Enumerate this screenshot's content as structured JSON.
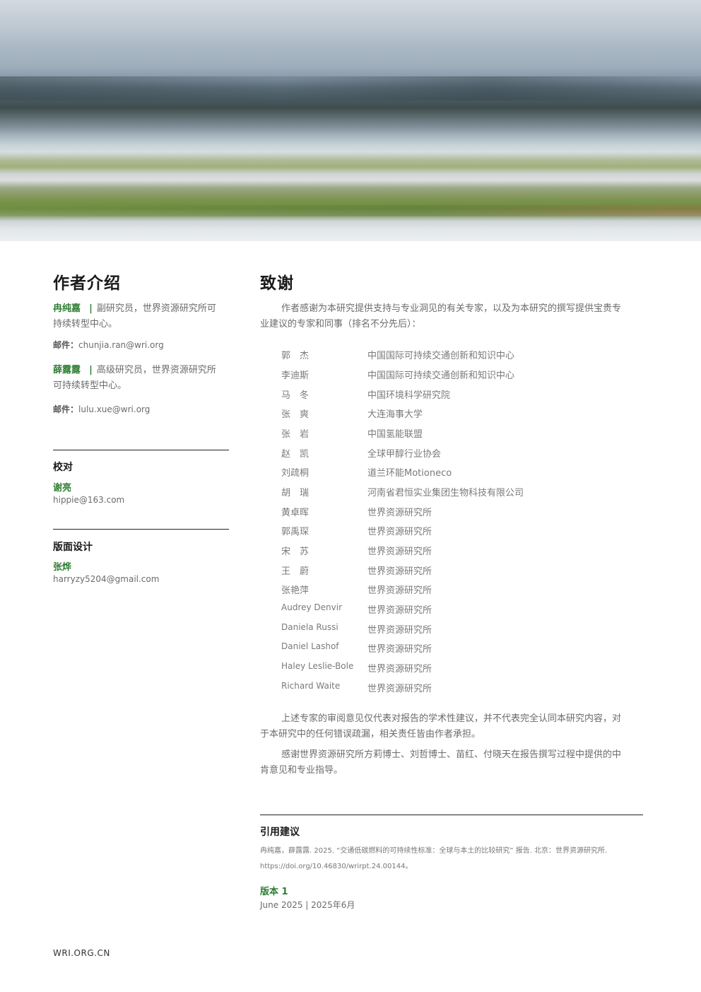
{
  "authors": {
    "heading": "作者介绍",
    "people": [
      {
        "name": "冉纯嘉",
        "sep": "|",
        "role_line1": "副研究员，世界资源研究所可",
        "role_line2": "持续转型中心。",
        "email_label": "邮件：",
        "email": "chunjia.ran@wri.org"
      },
      {
        "name": "薛露露",
        "sep": "|",
        "role_line1": "高级研究员，世界资源研究所",
        "role_line2": "可持续转型中心。",
        "email_label": "邮件：",
        "email": "lulu.xue@wri.org"
      }
    ],
    "proofread": {
      "title": "校对",
      "name": "谢亮",
      "email": "hippie@163.com"
    },
    "design": {
      "title": "版面设计",
      "name": "张烨",
      "email": "harryzy5204@gmail.com"
    }
  },
  "ack": {
    "heading": "致谢",
    "intro_line1": "作者感谢为本研究提供支持与专业洞见的有关专家，以及为本研究的撰写提供宝贵专",
    "intro_line2": "业建议的专家和同事（排名不分先后）：",
    "experts": [
      {
        "name": "郭　杰",
        "org": "中国国际可持续交通创新和知识中心"
      },
      {
        "name": "李迪斯",
        "org": "中国国际可持续交通创新和知识中心"
      },
      {
        "name": "马　冬",
        "org": "中国环境科学研究院"
      },
      {
        "name": "张　爽",
        "org": "大连海事大学"
      },
      {
        "name": "张　岩",
        "org": "中国氢能联盟"
      },
      {
        "name": "赵　凯",
        "org": "全球甲醇行业协会"
      },
      {
        "name": "刘疏桐",
        "org": "道兰环能Motioneco"
      },
      {
        "name": "胡　瑞",
        "org": "河南省君恒实业集团生物科技有限公司"
      },
      {
        "name": "黄卓晖",
        "org": "世界资源研究所"
      },
      {
        "name": "郭禹琛",
        "org": "世界资源研究所"
      },
      {
        "name": "宋　苏",
        "org": "世界资源研究所"
      },
      {
        "name": "王　蔚",
        "org": "世界资源研究所"
      },
      {
        "name": "张艳萍",
        "org": "世界资源研究所"
      },
      {
        "name": "Audrey Denvir",
        "org": "世界资源研究所"
      },
      {
        "name": "Daniela Russi",
        "org": "世界资源研究所"
      },
      {
        "name": "Daniel Lashof",
        "org": "世界资源研究所"
      },
      {
        "name": "Haley Leslie-Bole",
        "org": "世界资源研究所"
      },
      {
        "name": "Richard Waite",
        "org": "世界资源研究所"
      }
    ],
    "para2_line1": "上述专家的审阅意见仅代表对报告的学术性建议，并不代表完全认同本研究内容，对",
    "para2_line2": "于本研究中的任何错误疏漏，相关责任皆由作者承担。",
    "para3_line1": "感谢世界资源研究所方莉博士、刘哲博士、苗红、付晓天在报告撰写过程中提供的中",
    "para3_line2": "肯意见和专业指导。"
  },
  "citation": {
    "title": "引用建议",
    "line1": "冉纯嘉，薛露露. 2025. “交通低碳燃料的可持续性标准：全球与本土的比较研究” 报告. 北京：世界资源研究所.",
    "line2": "https://doi.org/10.46830/wrirpt.24.00144。",
    "version_label": "版本 1",
    "version_date": "June 2025 | 2025年6月"
  },
  "footer": {
    "site": "WRI.ORG.CN"
  }
}
